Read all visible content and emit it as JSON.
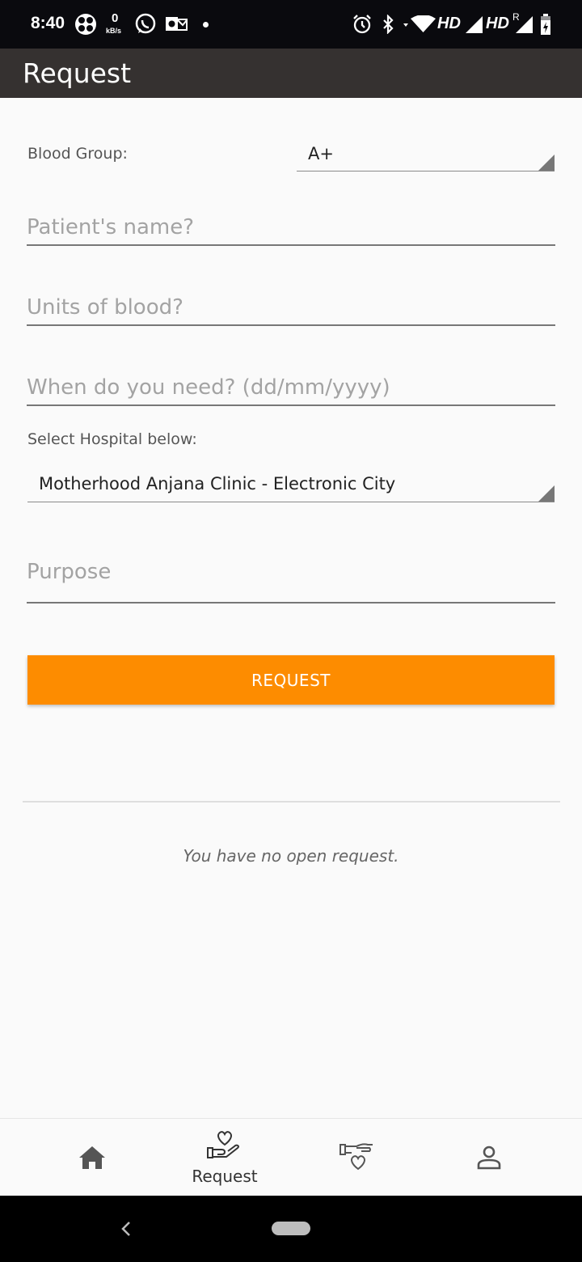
{
  "status_bar": {
    "time": "8:40",
    "net_speed_value": "0",
    "net_speed_unit": "kB/s",
    "hd1": "HD",
    "hd2": "HD",
    "roaming": "R",
    "icons": [
      "fan-icon",
      "whatsapp-icon",
      "outlook-icon",
      "dot-icon",
      "alarm-icon",
      "bluetooth-icon",
      "wifi-icon",
      "signal-icon",
      "battery-icon"
    ]
  },
  "app_bar": {
    "title": "Request"
  },
  "form": {
    "blood_group_label": "Blood Group:",
    "blood_group_value": "A+",
    "patient_name_placeholder": "Patient's name?",
    "units_placeholder": "Units of blood?",
    "date_placeholder": "When do you need? (dd/mm/yyyy)",
    "hospital_label": "Select Hospital below:",
    "hospital_value": "Motherhood Anjana Clinic - Electronic City",
    "purpose_placeholder": "Purpose",
    "submit_label": "REQUEST"
  },
  "requests": {
    "empty_message": "You have no open request."
  },
  "bottom_nav": {
    "items": [
      {
        "icon": "home-icon",
        "label": ""
      },
      {
        "icon": "hand-heart-icon",
        "label": "Request"
      },
      {
        "icon": "donate-heart-icon",
        "label": ""
      },
      {
        "icon": "person-icon",
        "label": ""
      }
    ],
    "active_index": 1
  },
  "colors": {
    "accent": "#fd8c00",
    "app_bar": "#353130",
    "status_bar": "#0a0a0e"
  }
}
